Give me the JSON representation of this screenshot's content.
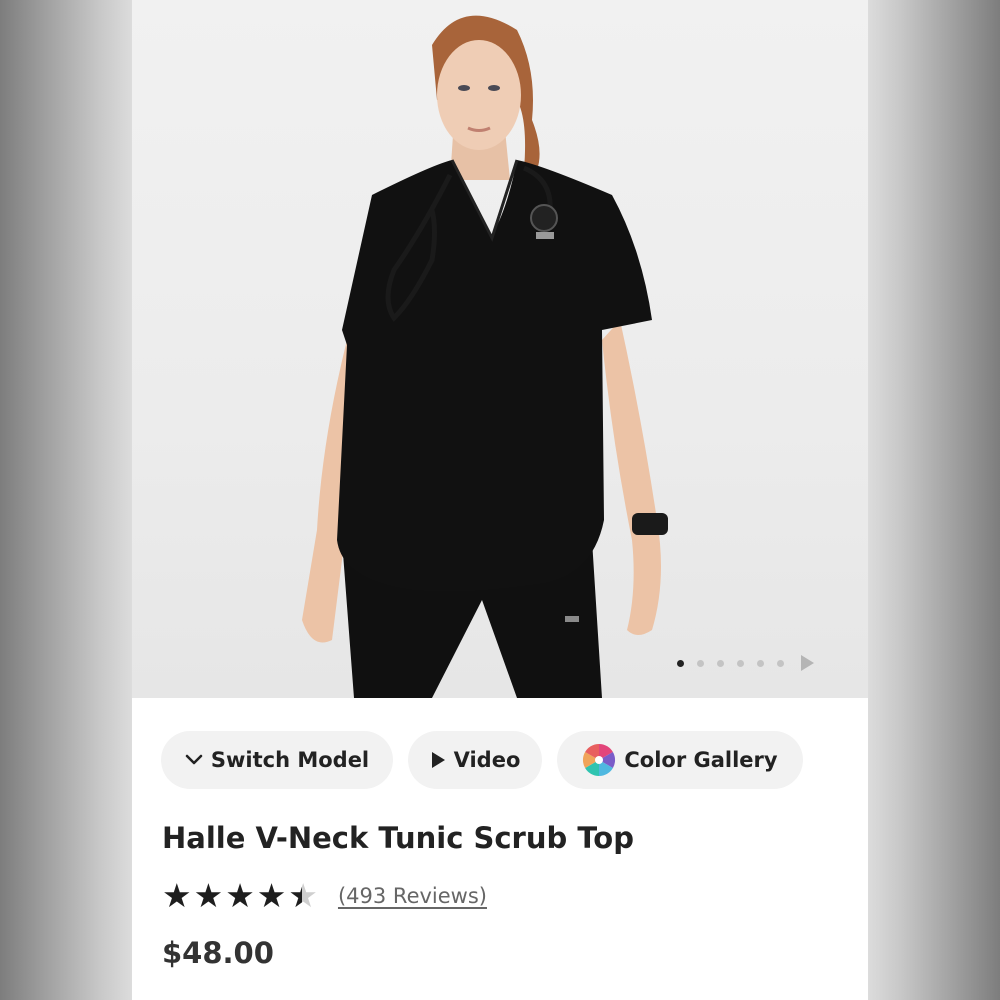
{
  "gallery": {
    "image_count": 6,
    "active_index": 0
  },
  "actions": {
    "switch_model_label": "Switch Model",
    "video_label": "Video",
    "color_gallery_label": "Color Gallery"
  },
  "product": {
    "title": "Halle V-Neck Tunic Scrub Top",
    "rating": 4.4,
    "rating_max": 5,
    "reviews_label": "(493 Reviews)",
    "price": "$48.00"
  },
  "colors": {
    "text": "#222222",
    "pill_bg": "#f2f2f2",
    "scrub": "#111111"
  }
}
